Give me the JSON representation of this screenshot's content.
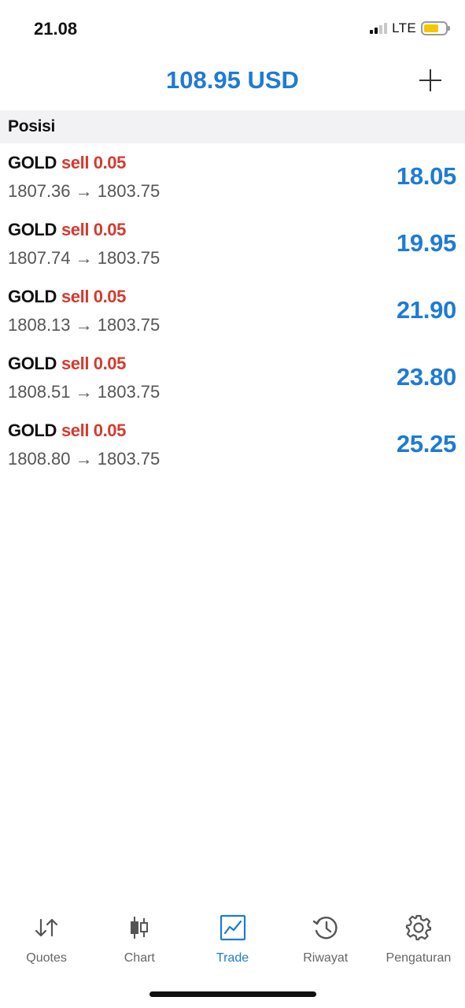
{
  "status": {
    "time": "21.08",
    "network": "LTE",
    "battery_color": "#f7c600"
  },
  "header": {
    "balance": "108.95 USD",
    "add_icon": "plus-icon"
  },
  "section": {
    "title": "Posisi"
  },
  "positions": [
    {
      "symbol": "GOLD",
      "side": "sell 0.05",
      "prices": "1807.36 → 1803.75",
      "profit": "18.05"
    },
    {
      "symbol": "GOLD",
      "side": "sell 0.05",
      "prices": "1807.74 → 1803.75",
      "profit": "19.95"
    },
    {
      "symbol": "GOLD",
      "side": "sell 0.05",
      "prices": "1808.13 → 1803.75",
      "profit": "21.90"
    },
    {
      "symbol": "GOLD",
      "side": "sell 0.05",
      "prices": "1808.51 → 1803.75",
      "profit": "23.80"
    },
    {
      "symbol": "GOLD",
      "side": "sell 0.05",
      "prices": "1808.80 → 1803.75",
      "profit": "25.25"
    }
  ],
  "tabs": [
    {
      "label": "Quotes",
      "icon": "arrows-up-down-icon",
      "active": false
    },
    {
      "label": "Chart",
      "icon": "candlestick-icon",
      "active": false
    },
    {
      "label": "Trade",
      "icon": "trend-chart-icon",
      "active": true
    },
    {
      "label": "Riwayat",
      "icon": "history-clock-icon",
      "active": false
    },
    {
      "label": "Pengaturan",
      "icon": "gear-icon",
      "active": false
    }
  ],
  "colors": {
    "accent": "#1e7bd4",
    "sell": "#d43a2f",
    "section_bg": "#f2f2f4"
  }
}
